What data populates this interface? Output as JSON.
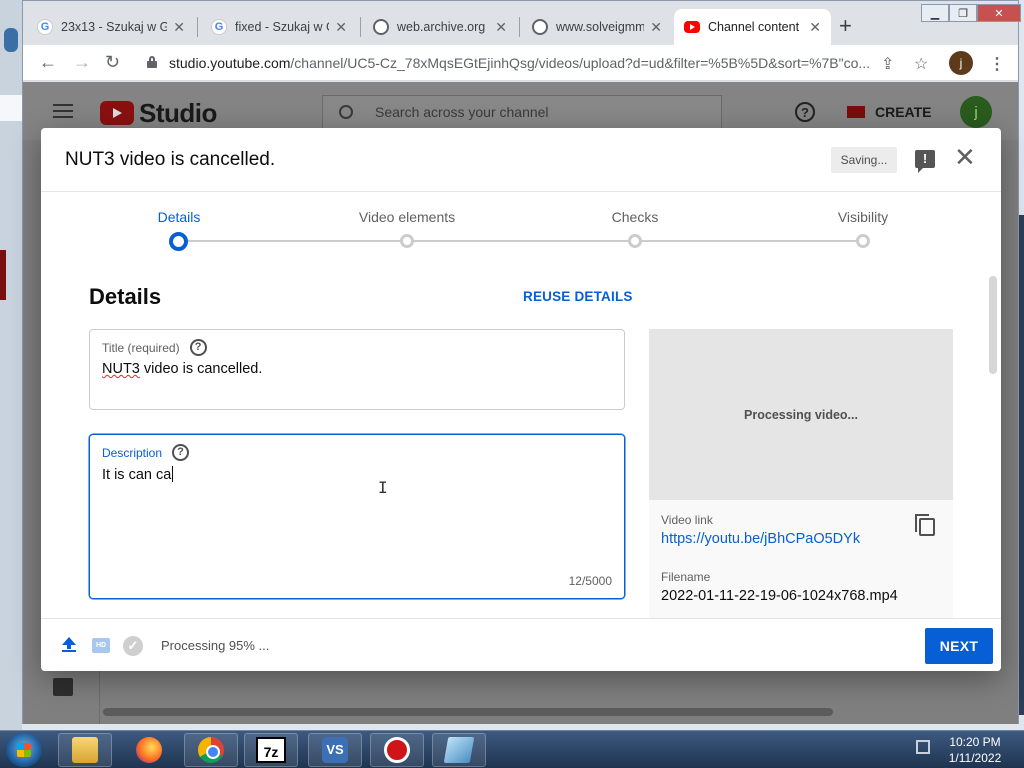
{
  "browser": {
    "tabs": [
      {
        "title": "23x13 - Szukaj w G",
        "favicon": "google-icon",
        "active": false
      },
      {
        "title": "fixed - Szukaj w G",
        "favicon": "google-icon",
        "active": false
      },
      {
        "title": "web.archive.org",
        "favicon": "globe-icon",
        "active": false
      },
      {
        "title": "www.solveigmm.c",
        "favicon": "globe-icon",
        "active": false
      },
      {
        "title": "Channel content",
        "favicon": "youtube-icon",
        "active": true
      }
    ],
    "url_host": "studio.youtube.com",
    "url_path": "/channel/UC5-Cz_78xMqsEGtEjinhQsg/videos/upload?d=ud&filter=%5B%5D&sort=%7B\"co...",
    "profile_initial": "j"
  },
  "studio": {
    "logo_text": "Studio",
    "search_placeholder": "Search across your channel",
    "create_label": "CREATE",
    "avatar_initial": "j"
  },
  "modal": {
    "title": "NUT3 video is cancelled.",
    "saving_label": "Saving...",
    "steps": [
      {
        "label": "Details",
        "active": true
      },
      {
        "label": "Video elements",
        "active": false
      },
      {
        "label": "Checks",
        "active": false
      },
      {
        "label": "Visibility",
        "active": false
      }
    ],
    "section_heading": "Details",
    "reuse_label": "REUSE DETAILS",
    "title_field": {
      "label": "Title (required)",
      "value_first": "NUT3",
      "value_rest": " video is cancelled."
    },
    "description_field": {
      "label": "Description",
      "value": "It is can ca",
      "counter": "12/5000"
    },
    "preview_text": "Processing video...",
    "video_link_label": "Video link",
    "video_link": "https://youtu.be/jBhCPaO5DYk",
    "filename_label": "Filename",
    "filename": "2022-01-11-22-19-06-1024x768.mp4",
    "footer_status": "Processing 95% ...",
    "processing_percent": 95,
    "next_label": "NEXT"
  },
  "taskbar": {
    "apps": [
      "explorer-icon",
      "firefox-icon",
      "chrome-icon",
      "7zip-icon",
      "visual-studio-icon",
      "recorder-icon",
      "app-icon"
    ],
    "time": "10:20 PM",
    "date": "1/11/2022"
  },
  "colors": {
    "accent": "#065fd4",
    "youtube_red": "#ff0000",
    "overlay": "#7f7f7f"
  }
}
